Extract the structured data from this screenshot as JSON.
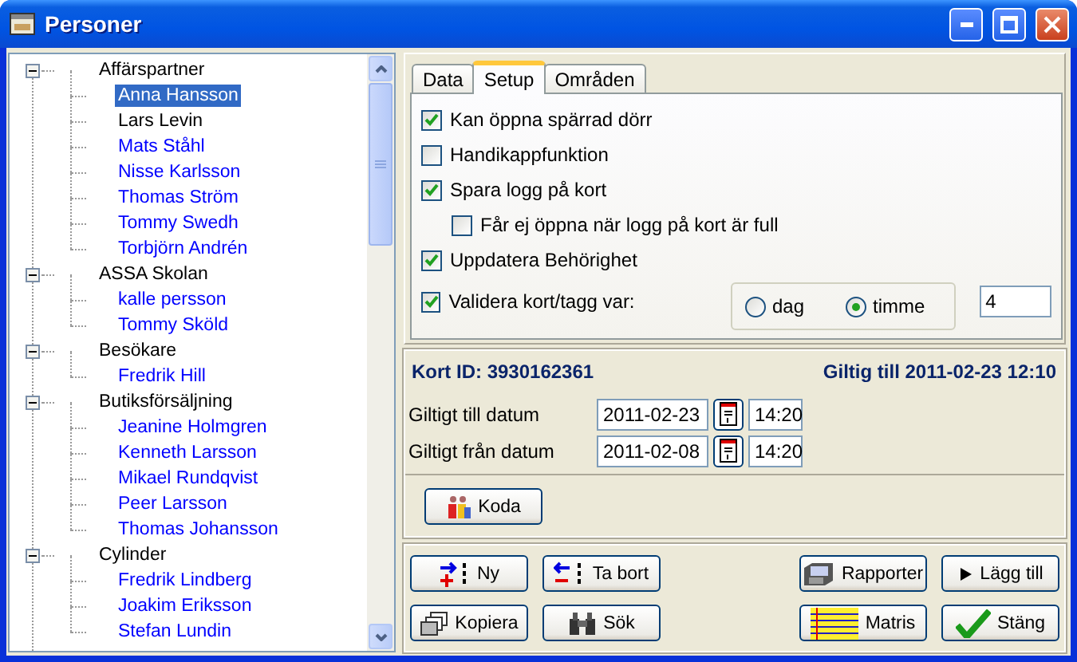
{
  "window": {
    "title": "Personer"
  },
  "tree": {
    "groups": [
      {
        "label": "Affärspartner",
        "expanded": true,
        "children": [
          {
            "label": "Anna Hansson",
            "selected": true
          },
          {
            "label": "Lars Levin",
            "selected": false,
            "color": "#000000"
          },
          {
            "label": "Mats Ståhl",
            "selected": false,
            "color": "#0000ff"
          },
          {
            "label": "Nisse Karlsson",
            "selected": false,
            "color": "#0000ff"
          },
          {
            "label": "Thomas Ström",
            "selected": false,
            "color": "#0000ff"
          },
          {
            "label": "Tommy Swedh",
            "selected": false,
            "color": "#0000ff"
          },
          {
            "label": "Torbjörn Andrén",
            "selected": false,
            "color": "#0000ff"
          }
        ]
      },
      {
        "label": "ASSA Skolan",
        "expanded": true,
        "children": [
          {
            "label": "kalle persson",
            "selected": false,
            "color": "#0000ff"
          },
          {
            "label": "Tommy Sköld",
            "selected": false,
            "color": "#0000ff"
          }
        ]
      },
      {
        "label": "Besökare",
        "expanded": true,
        "children": [
          {
            "label": "Fredrik Hill",
            "selected": false,
            "color": "#0000ff"
          }
        ]
      },
      {
        "label": "Butiksförsäljning",
        "expanded": true,
        "children": [
          {
            "label": "Jeanine Holmgren",
            "selected": false,
            "color": "#0000ff"
          },
          {
            "label": "Kenneth Larsson",
            "selected": false,
            "color": "#0000ff"
          },
          {
            "label": "Mikael Rundqvist",
            "selected": false,
            "color": "#0000ff"
          },
          {
            "label": "Peer Larsson",
            "selected": false,
            "color": "#0000ff"
          },
          {
            "label": "Thomas Johansson",
            "selected": false,
            "color": "#0000ff"
          }
        ]
      },
      {
        "label": "Cylinder",
        "expanded": true,
        "children": [
          {
            "label": "Fredrik Lindberg",
            "selected": false,
            "color": "#0000ff"
          },
          {
            "label": "Joakim Eriksson",
            "selected": false,
            "color": "#0000ff"
          },
          {
            "label": "Stefan Lundin",
            "selected": false,
            "color": "#0000ff"
          }
        ]
      }
    ]
  },
  "tabs": [
    {
      "label": "Data",
      "selected": false
    },
    {
      "label": "Setup",
      "selected": true
    },
    {
      "label": "Områden",
      "selected": false
    }
  ],
  "setup": {
    "options": [
      {
        "kind": "check",
        "label": "Kan öppna spärrad dörr",
        "checked": true
      },
      {
        "kind": "check",
        "label": "Handikappfunktion",
        "checked": false
      },
      {
        "kind": "check",
        "label": "Spara logg på kort",
        "checked": true,
        "children": [
          {
            "kind": "check",
            "label": "Får ej öppna när logg på kort är full",
            "checked": false
          }
        ]
      },
      {
        "kind": "check",
        "label": "Uppdatera Behörighet",
        "checked": true
      },
      {
        "kind": "interval",
        "label": "Validera kort/tagg var:",
        "checked": true,
        "radios": [
          {
            "label": "dag",
            "selected": false
          },
          {
            "label": "timme",
            "selected": true
          }
        ],
        "value": "4"
      }
    ]
  },
  "card": {
    "id_label": "Kort ID: 3930162361",
    "valid_until": "Giltig till 2011-02-23 12:10",
    "dates": [
      {
        "label": "Giltigt till datum",
        "date": "2011-02-23",
        "time": "14:20"
      },
      {
        "label": "Giltigt från datum",
        "date": "2011-02-08",
        "time": "14:20"
      }
    ],
    "code_button": "Koda"
  },
  "left_buttons": [
    {
      "kind": "new",
      "label": "Ny"
    },
    {
      "kind": "delete",
      "label": "Ta bort"
    },
    {
      "kind": "copy",
      "label": "Kopiera"
    },
    {
      "kind": "search",
      "label": "Sök"
    }
  ],
  "right_buttons": [
    {
      "kind": "report",
      "label": "Rapporter"
    },
    {
      "kind": "add",
      "label": "Lägg till"
    },
    {
      "kind": "matrix",
      "label": "Matris"
    },
    {
      "kind": "close",
      "label": "Stäng"
    }
  ]
}
